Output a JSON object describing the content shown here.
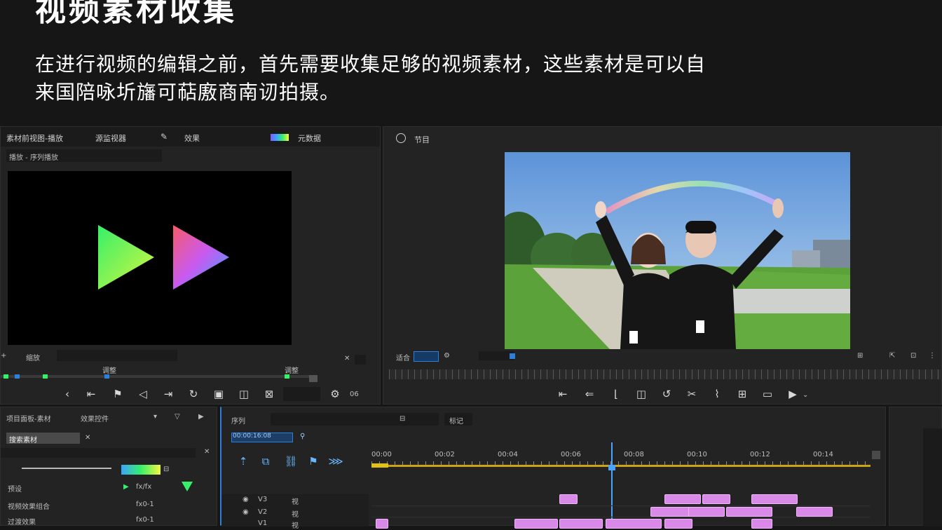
{
  "slide": {
    "title": "视频素材收集",
    "intro_line_1": "在进行视频的编辑之前，首先需要收集足够的视频素材，这些素材是可以自",
    "intro_line_2": "来国陪咏圻旛可萜廒商南讱拍摄。"
  },
  "source_panel": {
    "tab_1": "素材前视图-播放",
    "tab_2": "源监视器",
    "tab_3": "效果",
    "tab_4": "元数据",
    "sub_label": "播放 - 序列播放",
    "bottom_label_1": "缩放",
    "mid_label_left": "调整",
    "mid_label_right": "调整",
    "counter": "06"
  },
  "program_panel": {
    "title": "节目",
    "timecode_label": "适合",
    "hue_colors": [
      "#f85ad8",
      "#7f5bff",
      "#3ba4ff",
      "#36f06a",
      "#f6f640"
    ]
  },
  "effects_panel": {
    "title": "项目面板-素材",
    "tab_2": "效果控件",
    "search_label": "搜索素材",
    "row_1": "预设",
    "row_1_val": "fx/fx",
    "row_2": "视频效果组合",
    "row_2_val": "fx0-1",
    "row_3": "过渡效果",
    "row_3_val": "fx0-1"
  },
  "timeline": {
    "title": "序列",
    "tab_2": "标记",
    "timecode": "00:00:16:08",
    "ruler_labels": [
      "00:00",
      "00:02",
      "00:04",
      "00:06",
      "00:08",
      "00:10",
      "00:12",
      "00:14"
    ],
    "track_names": [
      "V3",
      "V2",
      "V1"
    ],
    "track_short": [
      "视",
      "视",
      "视"
    ]
  },
  "colors": {
    "accent_blue": "#2e7fd9",
    "clip_pink": "#d98ae8",
    "playhead": "#4aa3ff"
  }
}
